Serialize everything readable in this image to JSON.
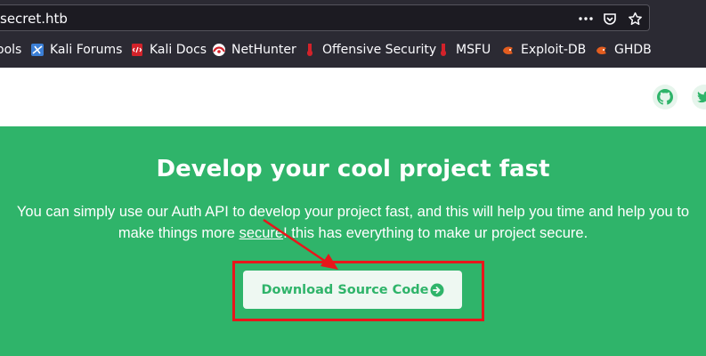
{
  "browser": {
    "url": "secret.htb",
    "bookmarks": [
      {
        "label": "ools",
        "icon": "tools-icon"
      },
      {
        "label": "Kali Forums",
        "icon": "kali-forums-icon"
      },
      {
        "label": "Kali Docs",
        "icon": "kali-docs-icon"
      },
      {
        "label": "NetHunter",
        "icon": "nethunter-icon"
      },
      {
        "label": "Offensive Security",
        "icon": "offsec-icon"
      },
      {
        "label": "MSFU",
        "icon": "msfu-icon"
      },
      {
        "label": "Exploit-DB",
        "icon": "exploit-db-icon"
      },
      {
        "label": "GHDB",
        "icon": "ghdb-icon"
      }
    ]
  },
  "hero": {
    "title": "Develop your cool project fast",
    "desc_before": "You can simply use our Auth API to develop your project fast, and this will help you time and help you to make things more ",
    "desc_link": "secure",
    "desc_after": "! this has everything to make ur project secure.",
    "download_label": "Download Source Code"
  },
  "colors": {
    "accent": "#2fb46a",
    "annotation": "#e8161b"
  }
}
